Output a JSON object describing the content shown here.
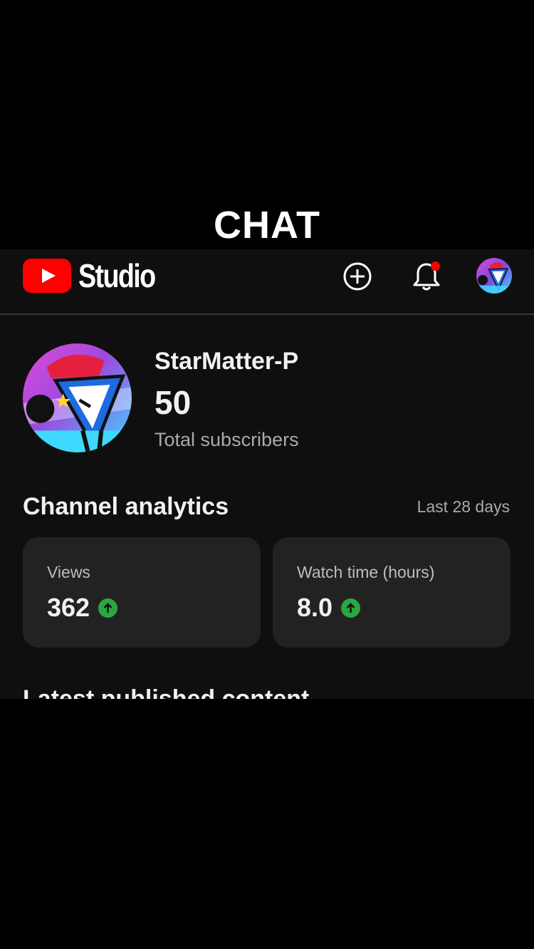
{
  "overlay": {
    "caption": "CHAT"
  },
  "header": {
    "logo_text": "Studio",
    "icons": {
      "create": "add-circle-icon",
      "notifications": "bell-icon",
      "account": "channel-avatar"
    },
    "notification_dot": true
  },
  "channel": {
    "name": "StarMatter-P",
    "subscribers": "50",
    "subscribers_label": "Total subscribers"
  },
  "analytics": {
    "title": "Channel analytics",
    "period": "Last 28 days",
    "cards": [
      {
        "label": "Views",
        "value": "362",
        "trend": "up"
      },
      {
        "label": "Watch time (hours)",
        "value": "8.0",
        "trend": "up"
      }
    ]
  },
  "latest": {
    "title": "Latest published content"
  },
  "colors": {
    "background": "#0f0f0f",
    "brand_red": "#ff0000",
    "trend_green": "#2ba640",
    "card_bg": "#222222",
    "secondary_text": "#aaaaaa"
  }
}
